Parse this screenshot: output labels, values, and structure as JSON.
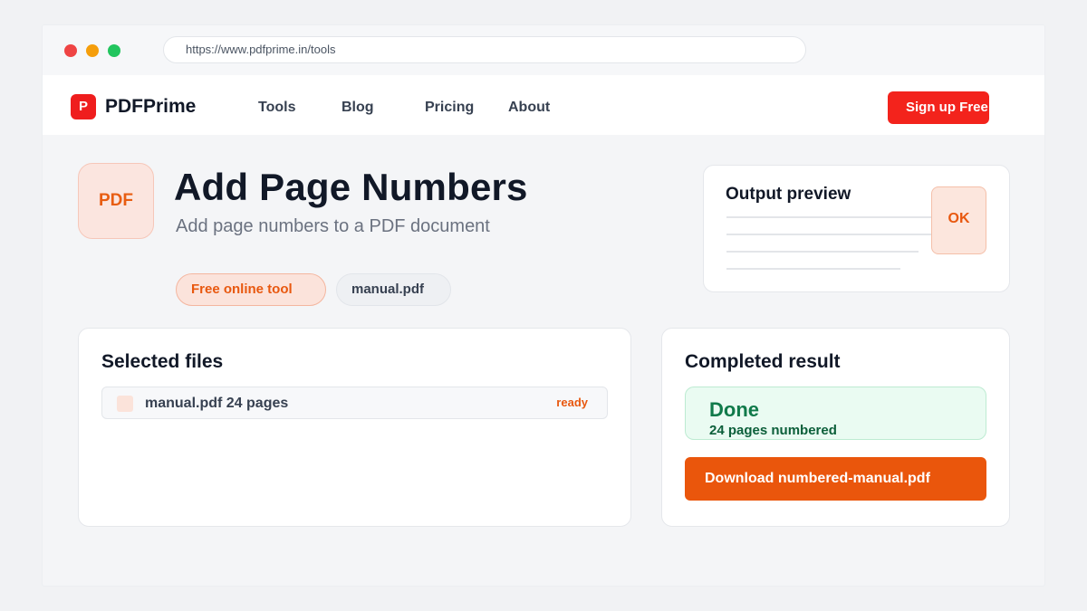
{
  "browser": {
    "url": "https://www.pdfprime.in/tools"
  },
  "brand": {
    "logo_letter": "P",
    "name": "PDFPrime"
  },
  "nav": {
    "links": [
      "Tools",
      "Blog",
      "Pricing",
      "About"
    ],
    "signup_label": "Sign up Free"
  },
  "hero": {
    "icon_label": "PDF",
    "title": "Add Page Numbers",
    "subtitle": "Add page numbers to a PDF document",
    "chips": [
      "Free online tool",
      "manual.pdf"
    ]
  },
  "preview": {
    "title": "Output preview",
    "badge": "OK"
  },
  "selected_files": {
    "title": "Selected files",
    "items": [
      {
        "label": "manual.pdf 24 pages",
        "status": "ready"
      }
    ]
  },
  "result": {
    "title": "Completed result",
    "status_title": "Done",
    "status_detail": "24 pages numbered",
    "download_label": "Download numbered-manual.pdf"
  },
  "colors": {
    "brand_red": "#f3231c",
    "accent_orange": "#ea560c",
    "success_green": "#107a4a"
  }
}
